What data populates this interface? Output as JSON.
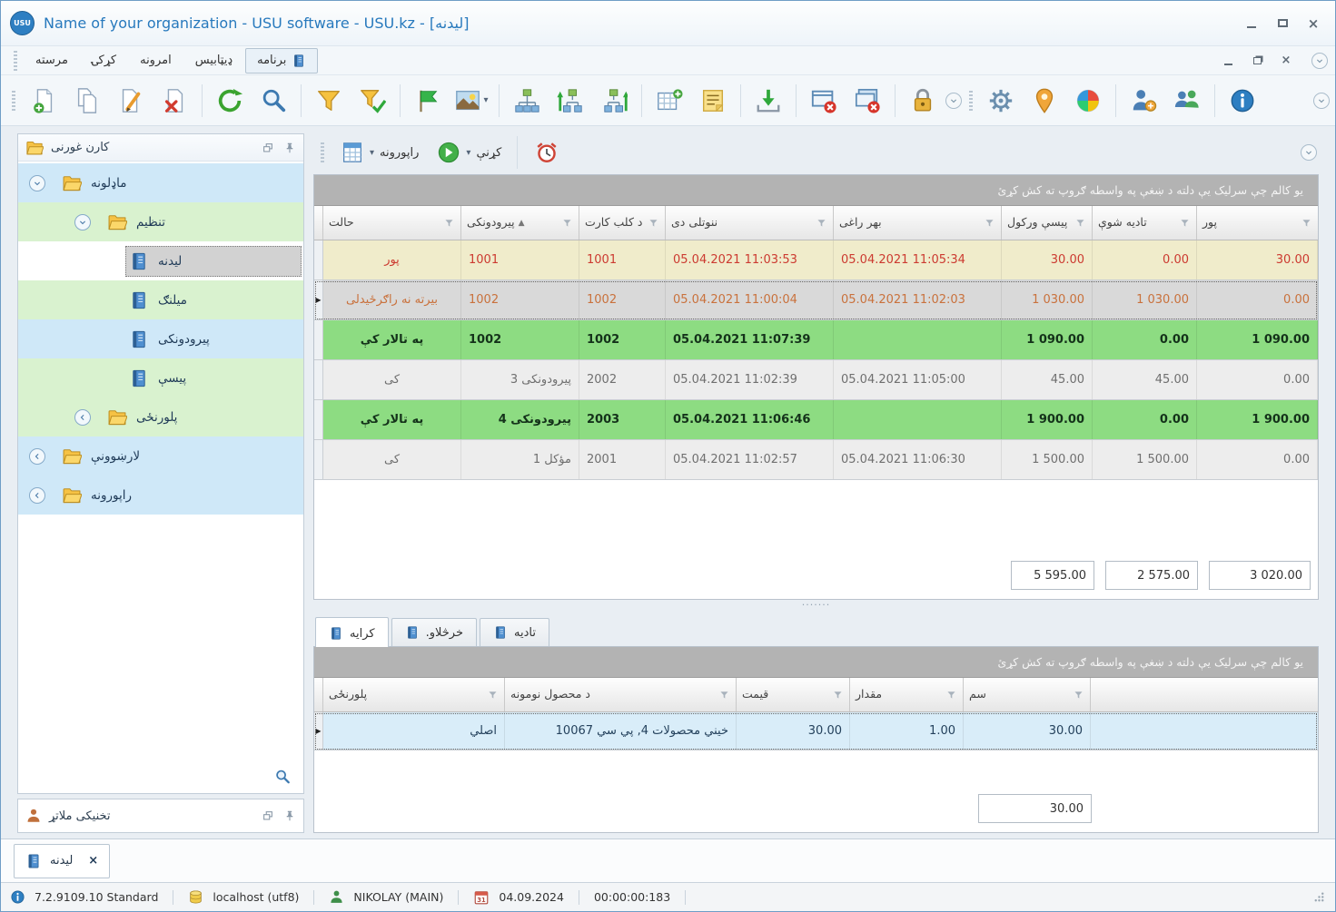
{
  "window": {
    "title": "Name of your organization - USU software - USU.kz - [ليدنه]",
    "logo_text": "USU"
  },
  "glyphs": {
    "caret_down": "▾",
    "sort_ascending": "▲",
    "row_marker": "▶",
    "close": "×",
    "splitter_dots": "·······"
  },
  "menu": {
    "items": [
      {
        "label": "مرسته",
        "selected": false
      },
      {
        "label": "کړکۍ",
        "selected": false
      },
      {
        "label": "امرونه",
        "selected": false
      },
      {
        "label": "ډيټابيس",
        "selected": false
      },
      {
        "label": "برنامه",
        "selected": true
      }
    ]
  },
  "toolbar": {
    "buttons": [
      "new-record",
      "copy-record",
      "edit-record",
      "delete-record",
      "refresh",
      "search",
      "filter",
      "apply-filter",
      "flag",
      "image-view",
      "tree-view",
      "collapse-hierarchy",
      "expand-hierarchy",
      "add-row",
      "notes",
      "import",
      "close-window",
      "close-all-windows",
      "lock",
      "more",
      "settings",
      "location",
      "color-scheme",
      "user-permissions",
      "users",
      "info"
    ]
  },
  "sidebar": {
    "title": "کارن غورنی",
    "tree": [
      {
        "label": "ماډلونه"
      },
      {
        "label": "تنظيم"
      },
      {
        "label": "ليدنه"
      },
      {
        "label": "ميلنګ"
      },
      {
        "label": "پيرودونکی"
      },
      {
        "label": "پيسې"
      },
      {
        "label": "پلورنځی"
      },
      {
        "label": "لارښوونې"
      },
      {
        "label": "راپورونه"
      }
    ],
    "support_panel_title": "تخنيکی ملاتړ"
  },
  "subtoolbar": {
    "reports_label": "راپورونه",
    "actions_label": "کړنې"
  },
  "group_panel_text": "يو کالم چې سرليک يې دلته د ښغې په واسطه ګروپ ته کش کړئ",
  "main_grid": {
    "columns": [
      "حالت",
      "پيرودونکی",
      "د کلب کارت",
      "ننوتلی دی",
      "بهر راغی",
      "پيسې ورکول",
      "تاديه شوې",
      "پور"
    ],
    "rows": [
      {
        "status": "پور",
        "customer": "1001",
        "card": "1001",
        "entered": "05.04.2021 11:03:53",
        "left": "05.04.2021 11:05:34",
        "payout": "30.00",
        "paid": "0.00",
        "debt": "30.00"
      },
      {
        "status": "بيرته نه راګرځيدلی",
        "customer": "1002",
        "card": "1002",
        "entered": "05.04.2021 11:00:04",
        "left": "05.04.2021 11:02:03",
        "payout": "1 030.00",
        "paid": "1 030.00",
        "debt": "0.00"
      },
      {
        "status": "په تالار کې",
        "customer": "1002",
        "card": "1002",
        "entered": "05.04.2021 11:07:39",
        "left": "",
        "payout": "1 090.00",
        "paid": "0.00",
        "debt": "1 090.00"
      },
      {
        "status": "کی",
        "customer": "پيرودونکی 3",
        "card": "2002",
        "entered": "05.04.2021 11:02:39",
        "left": "05.04.2021 11:05:00",
        "payout": "45.00",
        "paid": "45.00",
        "debt": "0.00"
      },
      {
        "status": "په تالار کې",
        "customer": "پيرودونکی 4",
        "card": "2003",
        "entered": "05.04.2021 11:06:46",
        "left": "",
        "payout": "1 900.00",
        "paid": "0.00",
        "debt": "1 900.00"
      },
      {
        "status": "کی",
        "customer": "مؤکل 1",
        "card": "2001",
        "entered": "05.04.2021 11:02:57",
        "left": "05.04.2021 11:06:30",
        "payout": "1 500.00",
        "paid": "1 500.00",
        "debt": "0.00"
      }
    ],
    "summary": {
      "payout_total": "5 595.00",
      "paid_total": "2 575.00",
      "debt_total": "3 020.00"
    }
  },
  "detail_tabs": [
    {
      "label": "کرايه",
      "active": true
    },
    {
      "label": "خرڅلاو.",
      "active": false
    },
    {
      "label": "تاديه",
      "active": false
    }
  ],
  "detail_grid": {
    "columns": [
      "پلورنځی",
      "د محصول نومونه",
      "قيمت",
      "مقدار",
      "سم"
    ],
    "rows": [
      {
        "store": "اصلي",
        "product": "خيني محصولات 4, پي سي 10067",
        "price": "30.00",
        "qty": "1.00",
        "total": "30.00"
      }
    ],
    "summary": {
      "total": "30.00"
    }
  },
  "document_tabs": [
    {
      "label": "ليدنه",
      "active": true
    }
  ],
  "statusbar": {
    "version": "7.2.9109.10 Standard",
    "database": "localhost (utf8)",
    "user": "NIKOLAY (MAIN)",
    "calendar_day": "31",
    "date": "04.09.2024",
    "timer": "00:00:00:183"
  },
  "colors": {
    "accent_blue": "#2779bd",
    "group_bar_bg": "#b3b3b3",
    "row_debt_bg": "#f0eccb",
    "row_debt_text": "#cc3a30",
    "row_focus_bg": "#d9d9d9",
    "row_focus_text": "#c9713c",
    "row_green_bg": "#8ddc82",
    "row_light_bg": "#ededed",
    "row_light_text": "#6f6f6f",
    "tree_blue": "#cfe8f8",
    "tree_green": "#d9f2cf",
    "tree_selected": "#d2d2d2",
    "detail_row_bg": "#d9edf9"
  }
}
